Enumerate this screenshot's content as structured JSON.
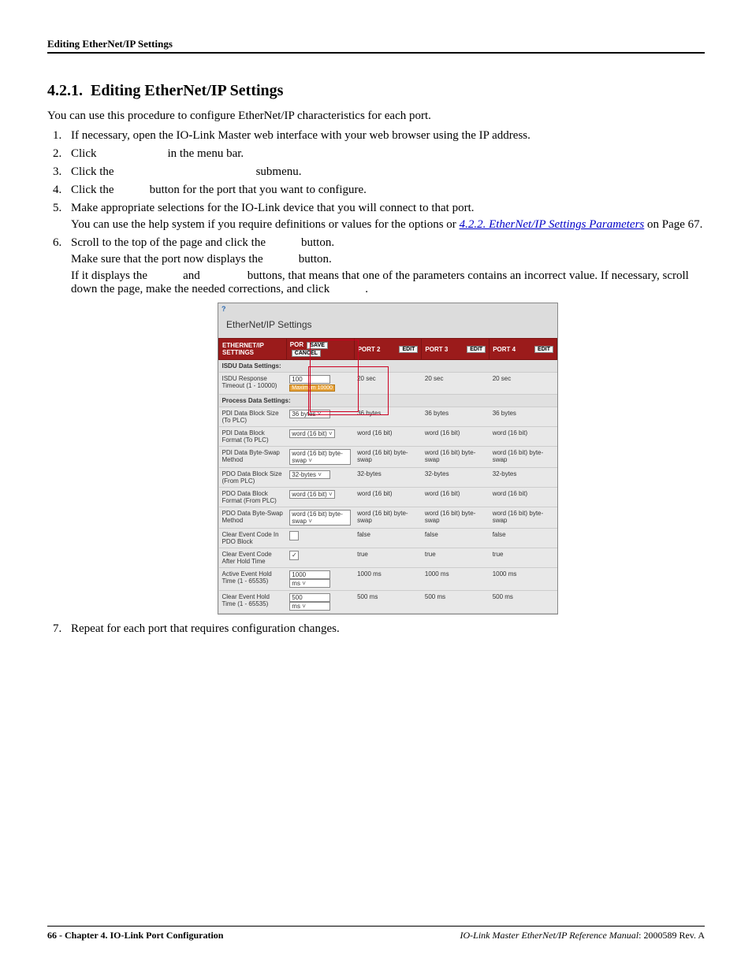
{
  "running_head": "Editing EtherNet/IP Settings",
  "section_number": "4.2.1.",
  "section_title": "Editing EtherNet/IP Settings",
  "intro": "You can use this procedure to configure EtherNet/IP characteristics for each port.",
  "steps": {
    "s1": "If necessary, open the IO-Link Master web interface with your web browser using the IP address.",
    "s2_a": "Click ",
    "s2_b": " in the menu bar.",
    "s3_a": "Click the ",
    "s3_b": " submenu.",
    "s4_a": "Click the ",
    "s4_b": " button for the port that you want to configure.",
    "s5_a": "Make appropriate selections for the IO-Link device that you will connect to that port.",
    "s5_b_a": "You can use the help system if you require definitions or values for the options or ",
    "s5_link": "4.2.2. EtherNet/IP Settings Parameters",
    "s5_b_b": " on Page 67.",
    "s6_a": "Scroll to the top of the page and click the ",
    "s6_a2": " button.",
    "s6_b": "Make sure that the port now displays the ",
    "s6_b2": " button.",
    "s6_c_a": "If it displays the ",
    "s6_c_b": " and ",
    "s6_c_c": " buttons, that means that one of the parameters contains an incorrect value. If necessary, scroll down the page, make the needed corrections, and click ",
    "s6_c_d": ".",
    "s7": "Repeat for each port that requires configuration changes."
  },
  "shot": {
    "help_icon": "?",
    "title": "EtherNet/IP Settings",
    "header": {
      "col1": "ETHERNET/IP SETTINGS",
      "port1": "POR",
      "save": "SAVE",
      "cancel": "CANCEL",
      "port2": "PORT 2",
      "port3": "PORT 3",
      "port4": "PORT 4",
      "edit": "EDIT"
    },
    "section_isdu": "ISDU Data Settings:",
    "r_isdu_timeout": {
      "label": "ISDU Response Timeout (1 - 10000)",
      "v1": "100",
      "tip": "Maximum 10000",
      "v2": "20 sec",
      "v3": "20 sec",
      "v4": "20 sec"
    },
    "section_pdata": "Process Data Settings:",
    "rows": [
      {
        "label": "PDI Data Block Size (To PLC)",
        "c1": "36 bytes",
        "sel": true,
        "c2": "36 bytes",
        "c3": "36 bytes",
        "c4": "36 bytes"
      },
      {
        "label": "PDI Data Block Format (To PLC)",
        "c1": "word (16 bit)",
        "sel": true,
        "c2": "word (16 bit)",
        "c3": "word (16 bit)",
        "c4": "word (16 bit)"
      },
      {
        "label": "PDI Data Byte-Swap Method",
        "c1": "word (16 bit) byte-swap",
        "sel": true,
        "c2": "word (16 bit) byte-swap",
        "c3": "word (16 bit) byte-swap",
        "c4": "word (16 bit) byte-swap"
      },
      {
        "label": "PDO Data Block Size (From PLC)",
        "c1": "32-bytes",
        "sel": true,
        "c2": "32-bytes",
        "c3": "32-bytes",
        "c4": "32-bytes"
      },
      {
        "label": "PDO Data Block Format (From PLC)",
        "c1": "word (16 bit)",
        "sel": true,
        "c2": "word (16 bit)",
        "c3": "word (16 bit)",
        "c4": "word (16 bit)"
      },
      {
        "label": "PDO Data Byte-Swap Method",
        "c1": "word (16 bit) byte-swap",
        "sel": true,
        "c2": "word (16 bit) byte-swap",
        "c3": "word (16 bit) byte-swap",
        "c4": "word (16 bit) byte-swap"
      }
    ],
    "chk_rows": [
      {
        "label": "Clear Event Code In PDO Block",
        "checked": false,
        "v": "false"
      },
      {
        "label": "Clear Event Code After Hold Time",
        "checked": true,
        "v": "true"
      }
    ],
    "num_rows": [
      {
        "label": "Active Event Hold Time (1 - 65535)",
        "v1": "1000",
        "unit": "ms",
        "v": "1000 ms"
      },
      {
        "label": "Clear Event Hold Time (1 - 65535)",
        "v1": "500",
        "unit": "ms",
        "v": "500 ms"
      }
    ]
  },
  "footer": {
    "left_a": "66 - Chapter 4. IO-Link Port Configuration",
    "right_a": "IO-Link Master EtherNet/IP Reference Manual",
    "right_b": ": 2000589 Rev. A"
  }
}
